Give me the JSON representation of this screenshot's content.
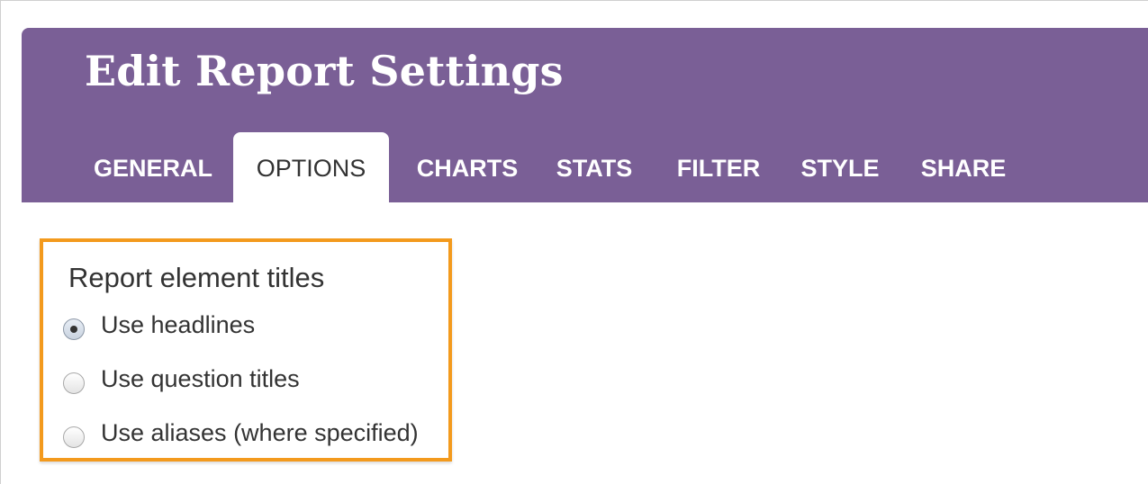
{
  "header": {
    "title": "Edit Report Settings",
    "background_color": "#7a5f96"
  },
  "tabs": [
    {
      "label": "GENERAL",
      "active": false
    },
    {
      "label": "OPTIONS",
      "active": true
    },
    {
      "label": "CHARTS",
      "active": false
    },
    {
      "label": "STATS",
      "active": false
    },
    {
      "label": "FILTER",
      "active": false
    },
    {
      "label": "STYLE",
      "active": false
    },
    {
      "label": "SHARE",
      "active": false
    }
  ],
  "panel": {
    "title": "Report element titles",
    "highlight_color": "#f39a1d",
    "options": [
      {
        "label": "Use headlines",
        "selected": true
      },
      {
        "label": "Use question titles",
        "selected": false
      },
      {
        "label": "Use aliases (where specified)",
        "selected": false
      }
    ]
  }
}
